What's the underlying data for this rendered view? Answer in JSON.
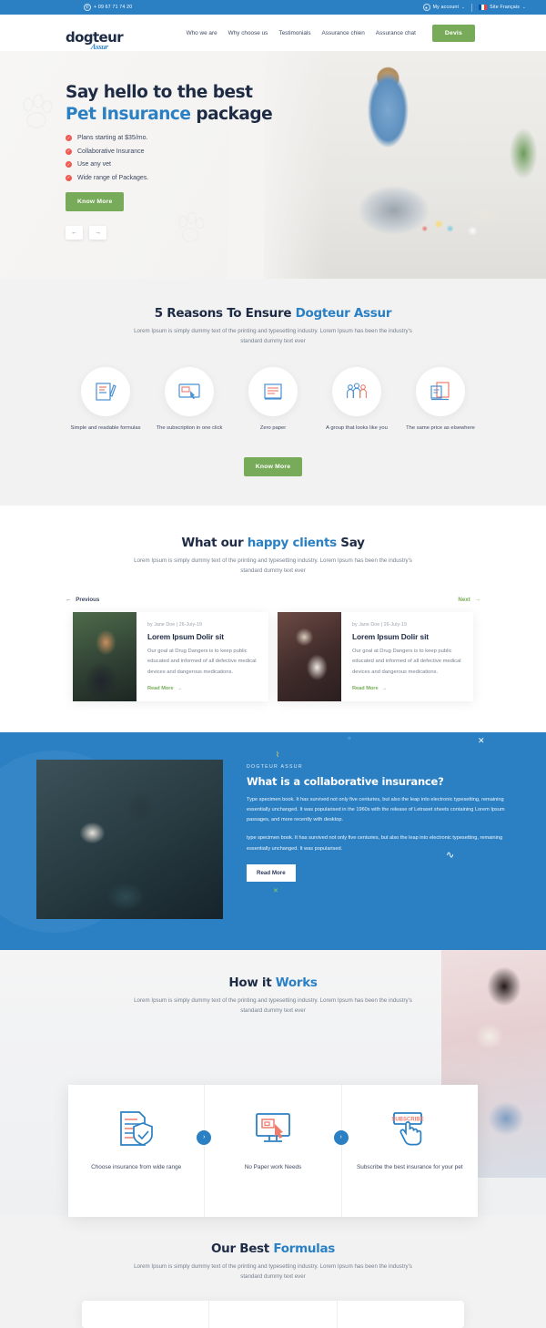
{
  "topbar": {
    "phone": "+ 09 67 71 74 20",
    "phone_icon": "phone-icon",
    "account_label": "My account",
    "account_icon": "user-icon",
    "language_label": "Site Français",
    "flag_icon": "french-flag-icon",
    "caret": "⌄"
  },
  "nav": {
    "logo_main": "dogteur",
    "logo_sub": "Assur",
    "links": [
      {
        "label": "Who we are"
      },
      {
        "label": "Why choose us"
      },
      {
        "label": "Testimonials"
      },
      {
        "label": "Assurance chien"
      },
      {
        "label": "Assurance chat"
      }
    ],
    "cta_label": "Devis"
  },
  "hero": {
    "title_line1": "Say hello to the best",
    "title_accent": "Pet Insurance",
    "title_tail": " package",
    "bullets": [
      "Plans starting at $35/mo.",
      "Collaborative Insurance",
      "Use any vet",
      "Wide range of Packages."
    ],
    "bullet_icon": "check-circle-icon",
    "cta_label": "Know More",
    "prev_icon": "arrow-left-icon",
    "next_icon": "arrow-right-icon",
    "prev_glyph": "←",
    "next_glyph": "→"
  },
  "reasons": {
    "title_main": "5 Reasons To Ensure ",
    "title_accent": "Dogteur Assur",
    "subtitle": "Lorem Ipsum is simply dummy text of the printing and typesetting industry. Lorem Ipsum has been the industry's standard dummy text ever",
    "items": [
      {
        "label": "Simple and readable formulas",
        "icon": "document-pen-icon"
      },
      {
        "label": "The subscription in one click",
        "icon": "monitor-click-icon"
      },
      {
        "label": "Zero paper",
        "icon": "no-paper-icon"
      },
      {
        "label": "A group that looks like you",
        "icon": "group-people-icon"
      },
      {
        "label": "The same price as elsewhere",
        "icon": "price-tag-icon"
      }
    ],
    "cta_label": "Know More"
  },
  "testimonials": {
    "title_main": "What our ",
    "title_accent": "happy clients",
    "title_tail": " Say",
    "subtitle": "Lorem Ipsum is simply dummy text of the printing and typesetting industry. Lorem Ipsum has been the industry's standard dummy text ever",
    "prev_label": "Previous",
    "next_label": "Next",
    "prev_glyph": "←",
    "next_glyph": "→",
    "cards": [
      {
        "meta": "by Jane Doe  |  26-July-19",
        "title": "Lorem Ipsum Dolir sit",
        "text": "Our goal at Drug Dangers is to keep public educated and informed of all defective medical devices and dangerous medications.",
        "link_label": "Read More",
        "link_glyph": "→",
        "photo_alt": "man-hugging-dog-photo"
      },
      {
        "meta": "by Jane Doe  |  26-July-19",
        "title": "Lorem Ipsum Dolir sit",
        "text": "Our goal at Drug Dangers is to keep public educated and informed of all defective medical devices and dangerous medications.",
        "link_label": "Read More",
        "link_glyph": "→",
        "photo_alt": "woman-holding-dog-photo"
      }
    ]
  },
  "collaborative": {
    "kicker": "DOGTEUR ASSUR",
    "title": "What is a collaborative insurance?",
    "paragraph1": "Type specimen book. It has survived not only five centuries, but also the leap into electronic typesetting, remaining essentially unchanged. It was popularised in the 1960s with the release of Letraset sheets containing Lorem Ipsum passages, and more recently with desktop.",
    "paragraph2": "type specimen book. It has survived not only five centuries, but also the leap into electronic typesetting, remaining essentially unchanged. It was popularised.",
    "cta_label": "Read More",
    "photo_alt": "couple-with-dog-photo"
  },
  "how": {
    "title_main": "How it ",
    "title_accent": "Works",
    "subtitle": "Lorem Ipsum is simply dummy text of the printing and typesetting industry. Lorem Ipsum has been the industry's standard dummy text ever",
    "photo_alt": "woman-holding-cat-photo",
    "chevron_glyph": "›",
    "steps": [
      {
        "label": "Choose insurance from wide range",
        "icon": "document-shield-icon"
      },
      {
        "label": "No Paper work Needs",
        "icon": "monitor-cursor-icon"
      },
      {
        "label": "Subscribe the best insurance for your pet",
        "icon": "subscribe-hand-icon",
        "badge": "SUBSCRIBE"
      }
    ]
  },
  "formulas": {
    "title_main": "Our Best ",
    "title_accent": "Formulas",
    "subtitle": "Lorem Ipsum is simply dummy text of the printing and typesetting industry. Lorem Ipsum has been the industry's standard dummy text ever"
  },
  "colors": {
    "brand_blue": "#2b80c4",
    "dark_navy": "#1e2b45",
    "green": "#77ab59",
    "red_accent": "#ee5a52",
    "light_gray": "#f2f2f2"
  }
}
